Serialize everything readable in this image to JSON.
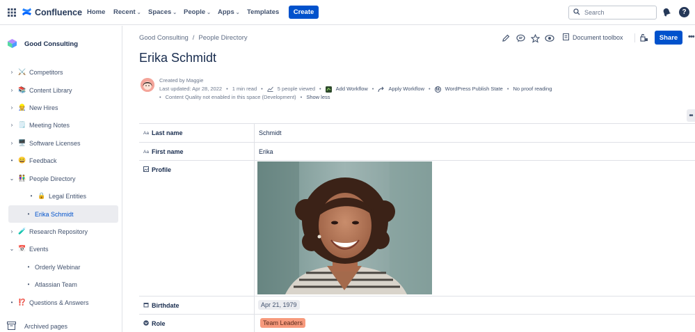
{
  "topnav": {
    "product_name": "Confluence",
    "items": [
      {
        "label": "Home",
        "has_dropdown": false
      },
      {
        "label": "Recent",
        "has_dropdown": true
      },
      {
        "label": "Spaces",
        "has_dropdown": true
      },
      {
        "label": "People",
        "has_dropdown": true
      },
      {
        "label": "Apps",
        "has_dropdown": true
      },
      {
        "label": "Templates",
        "has_dropdown": false
      }
    ],
    "create_label": "Create",
    "search_placeholder": "Search",
    "icons": [
      "app-switcher-icon",
      "confluence-logo-icon",
      "search-icon",
      "notifications-icon",
      "help-icon"
    ]
  },
  "sidebar": {
    "space_name": "Good Consulting",
    "items": [
      {
        "label": "Competitors",
        "toggle": "›",
        "emoji": "⚔️"
      },
      {
        "label": "Content Library",
        "toggle": "›",
        "emoji": "📚"
      },
      {
        "label": "New Hires",
        "toggle": "›",
        "emoji": "👷"
      },
      {
        "label": "Meeting Notes",
        "toggle": "›",
        "emoji": "🗒️"
      },
      {
        "label": "Software Licenses",
        "toggle": "›",
        "emoji": "🖥️"
      },
      {
        "label": "Feedback",
        "toggle": "•",
        "emoji": "😀"
      },
      {
        "label": "People Directory",
        "toggle": "⌄",
        "emoji": "👫"
      },
      {
        "label": "Legal Entities",
        "toggle": "•",
        "emoji": "🔒"
      },
      {
        "label": "Erika Schmidt",
        "toggle": "•",
        "emoji": ""
      },
      {
        "label": "Research Repository",
        "toggle": "›",
        "emoji": "🧪"
      },
      {
        "label": "Events",
        "toggle": "⌄",
        "emoji": "📅"
      },
      {
        "label": "Orderly Webinar",
        "toggle": "•",
        "emoji": ""
      },
      {
        "label": "Atlassian Team",
        "toggle": "•",
        "emoji": ""
      },
      {
        "label": "Questions & Answers",
        "toggle": "•",
        "emoji": "⁉️"
      }
    ],
    "selected_item": "Erika Schmidt",
    "archived_label": "Archived pages"
  },
  "page": {
    "breadcrumb": [
      "Good Consulting",
      "People Directory"
    ],
    "breadcrumb_separator": "/",
    "title": "Erika Schmidt",
    "actions": {
      "icons": [
        "edit-icon",
        "comment-icon",
        "star-icon",
        "watch-icon"
      ],
      "document_toolbox_label": "Document toolbox",
      "share_label": "Share"
    }
  },
  "byline": {
    "created_by": "Created by Maggie",
    "last_updated": "Last updated: Apr 28, 2022",
    "read_time": "1 min read",
    "viewed": "5 people viewed",
    "add_workflow": "Add Workflow",
    "apply_workflow": "Apply Workflow",
    "wordpress_state": "WordPress Publish State",
    "proof_reading": "No proof reading",
    "content_quality": "Content Quality not enabled in this space (Development)",
    "show_less": "Show less"
  },
  "properties": {
    "type_icon_text": "Aa",
    "rows": [
      {
        "label": "Last name",
        "value": "Schmidt"
      },
      {
        "label": "First name",
        "value": "Erika"
      },
      {
        "label": "Profile",
        "value": ""
      },
      {
        "label": "Birthdate",
        "value": "Apr 21, 1979"
      },
      {
        "label": "Role",
        "value": "Team Leaders"
      }
    ]
  },
  "colors": {
    "primary": "#0052cc",
    "text": "#172b4d",
    "subtle": "#6b778c",
    "tag_background": "#f79a7d",
    "selected_background": "#ebecf0"
  }
}
